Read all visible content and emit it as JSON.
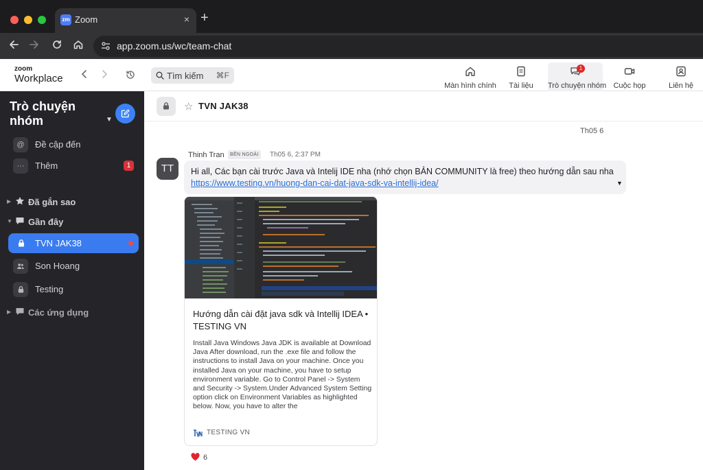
{
  "browser": {
    "tab_title": "Zoom",
    "tab_favicon": "zm",
    "tab_close": "×",
    "new_tab": "+",
    "url": "app.zoom.us/wc/team-chat",
    "icons": [
      "back-arrow-icon",
      "forward-arrow-icon",
      "reload-icon",
      "home-icon",
      "site-info-icon"
    ]
  },
  "zoombar": {
    "logo_small": "zoom",
    "logo_big": "Workplace",
    "search_placeholder": "Tìm kiếm",
    "search_shortcut": "⌘F",
    "nav": [
      {
        "label": "Màn hình chính",
        "icon": "home-icon"
      },
      {
        "label": "Tài liệu",
        "icon": "document-icon"
      },
      {
        "label": "Trò chuyện nhóm",
        "icon": "chat-icon",
        "badge": "1",
        "active": true
      },
      {
        "label": "Cuộc họp",
        "icon": "video-camera-icon"
      },
      {
        "label": "Liên hệ",
        "icon": "contacts-icon"
      }
    ]
  },
  "sidebar": {
    "title": "Trò chuyện nhóm",
    "top_items": [
      {
        "label": "Đề cập đến",
        "icon": "at-icon",
        "glyph": "@"
      },
      {
        "label": "Thêm",
        "icon": "more-icon",
        "glyph": "···",
        "badge": "1"
      }
    ],
    "sections": {
      "starred": "Đã gắn sao",
      "recent": "Gần đây",
      "apps": "Các ứng dụng"
    },
    "recent_items": [
      {
        "label": "TVN JAK38",
        "icon": "lock-icon",
        "active": true,
        "unread": true
      },
      {
        "label": "Son Hoang",
        "icon": "people-icon"
      },
      {
        "label": "Testing",
        "icon": "lock-icon"
      }
    ]
  },
  "chat": {
    "title": "TVN JAK38",
    "date_divider": "Th05 6",
    "message": {
      "avatar_initials": "TT",
      "sender": "Thinh Tran",
      "tag": "BÊN NGOÀI",
      "time": "Th05 6, 2:37 PM",
      "text": "Hi all, Các bạn cài trước Java và Intelij IDE nha (nhớ chọn BẢN COMMUNITY là free) theo hướng dẫn sau nha",
      "link": "https://www.testing.vn/huong-dan-cai-dat-java-sdk-va-intellij-idea/",
      "preview": {
        "title": "Hướng dẫn cài đặt java sdk và Intellij IDEA • TESTING VN",
        "description": "Install Java Windows Java JDK is available at Download Java After download, run the .exe file and follow the instructions to install Java on your machine. Once you installed Java on your machine, you have to setup environment variable. Go to Control Panel -> System and Security -> System.Under Advanced System Setting option click on Environment Variables as highlighted below. Now, you have to alter the",
        "source": "TESTING VN"
      },
      "reaction": {
        "icon": "heart-icon",
        "count": "6"
      }
    }
  }
}
